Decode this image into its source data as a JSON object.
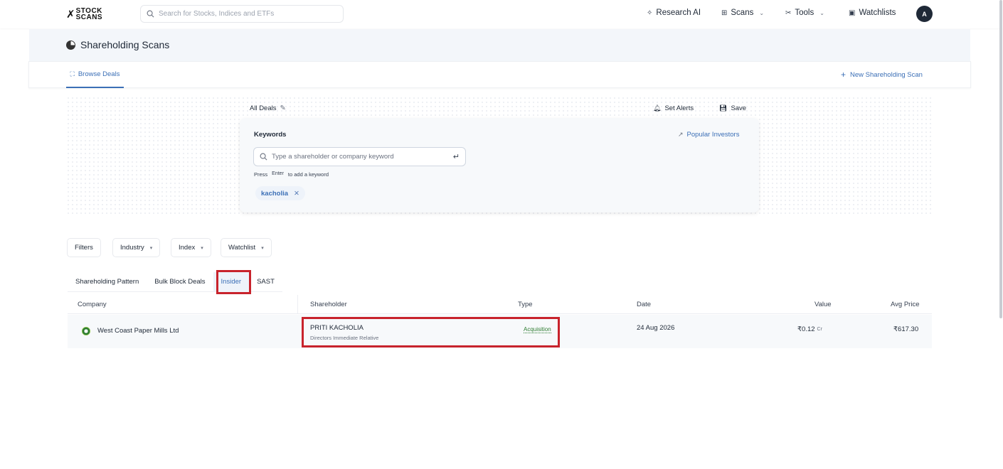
{
  "nav": {
    "logo_line1": "STOCK",
    "logo_line2": "SCANS",
    "search_placeholder": "Search for Stocks, Indices and ETFs",
    "research_ai": "Research AI",
    "scans": "Scans",
    "tools": "Tools",
    "watchlists": "Watchlists",
    "avatar_initial": "A"
  },
  "header": {
    "title": "Shareholding Scans",
    "browse_tab": "Browse Deals",
    "new_scan": "New Shareholding Scan"
  },
  "deals": {
    "all_deals": "All Deals",
    "set_alerts": "Set Alerts",
    "save": "Save"
  },
  "keywords": {
    "label": "Keywords",
    "popular": "Popular Investors",
    "placeholder": "Type a shareholder or company keyword",
    "hint_press": "Press",
    "hint_key": "Enter",
    "hint_rest": "to add a keyword",
    "chips": [
      "kacholia"
    ]
  },
  "filters": {
    "filters": "Filters",
    "industry": "Industry",
    "index": "Index",
    "watchlist": "Watchlist"
  },
  "tabs": [
    "Shareholding Pattern",
    "Bulk Block Deals",
    "Insider",
    "SAST"
  ],
  "active_tab": "Insider",
  "table": {
    "headers": {
      "company": "Company",
      "shareholder": "Shareholder",
      "type": "Type",
      "date": "Date",
      "value": "Value",
      "avg_price": "Avg Price"
    },
    "rows": [
      {
        "company": "West Coast Paper Mills Ltd",
        "shareholder": "PRITI KACHOLIA",
        "shareholder_role": "Directors Immediate Relative",
        "type": "Acquisition",
        "date": "24 Aug 2026",
        "value": "₹0.12",
        "avg_price": "₹617.30"
      }
    ]
  },
  "colors": {
    "accent": "#3b6fb6",
    "highlight": "#c8232c",
    "positive": "#2e7d32"
  }
}
